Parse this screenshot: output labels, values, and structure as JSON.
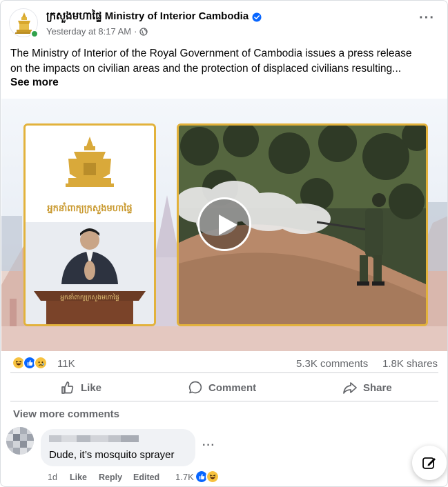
{
  "post": {
    "page_name": "ក្រសួងមហាផ្ទៃ Ministry of Interior Cambodia",
    "timestamp": "Yesterday at 8:17 AM",
    "separator": "·",
    "privacy_icon": "globe-icon",
    "verified_icon": "verified-badge-icon",
    "more_label": "···",
    "text_line1": "The Ministry of Interior of the Royal Government of Cambodia issues a press release",
    "text_line2": "on the impacts on civilian areas and the protection of displaced civilians resulting...",
    "see_more": "See more",
    "media": {
      "left_banner_text": "អ្នកនាំពាក្យក្រសួងមហាផ្ទៃ",
      "podium_text": "អ្នកនាំពាក្យក្រសួងមហាផ្ទៃ",
      "play_icon": "play-icon"
    }
  },
  "stats": {
    "reaction_icons": [
      "haha",
      "like",
      "sad"
    ],
    "reaction_count": "11K",
    "comments": "5.3K comments",
    "shares": "1.8K shares"
  },
  "actions": {
    "like": "Like",
    "comment": "Comment",
    "share": "Share"
  },
  "comments_section": {
    "view_more": "View more comments",
    "comment": {
      "text": "Dude, it’s mosquito sprayer",
      "more_label": "···",
      "age": "1d",
      "like": "Like",
      "reply": "Reply",
      "edited": "Edited",
      "reaction_count": "1.7K",
      "reaction_icons": [
        "like",
        "haha"
      ]
    }
  },
  "colors": {
    "accent_blue": "#0866ff",
    "frame_gold": "#e2b23c",
    "secondary_text": "#65676b"
  }
}
